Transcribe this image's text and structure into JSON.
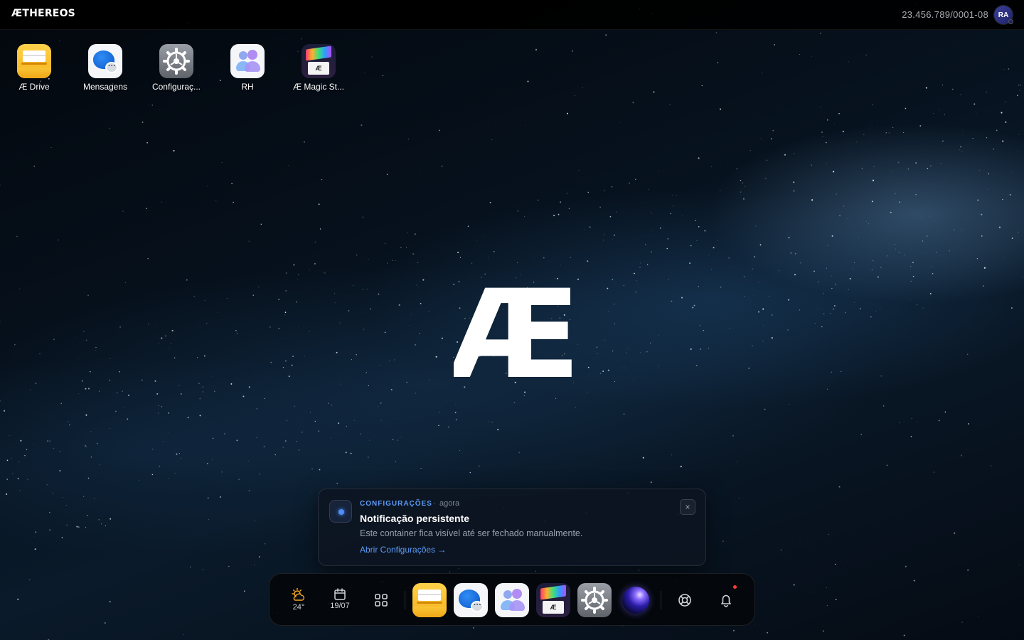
{
  "topbar": {
    "brand": "ÆTHEREOS",
    "tax_id": "23.456.789/0001-08",
    "avatar_initials": "RA"
  },
  "desktop": {
    "icons": [
      {
        "label": "Æ Drive",
        "icon": "drive-icon"
      },
      {
        "label": "Mensagens",
        "icon": "messages-icon"
      },
      {
        "label": "Configuraç...",
        "icon": "settings-gear-icon"
      },
      {
        "label": "RH",
        "icon": "people-icon"
      },
      {
        "label": "Æ Magic St...",
        "icon": "magic-store-icon"
      }
    ],
    "center_logo": "Æ"
  },
  "notification": {
    "app": "CONFIGURAÇÕES",
    "separator": "·",
    "time": "agora",
    "title": "Notificação persistente",
    "body": "Este container fica visível até ser fechado manualmente.",
    "link": "Abrir Configurações →",
    "close": "×",
    "accent_color": "#5b9af7"
  },
  "dock": {
    "weather": {
      "temp": "24°",
      "icon": "partly-cloudy-sun-icon"
    },
    "date": {
      "label": "19/07",
      "icon": "calendar-icon"
    },
    "launcher_icon": "grid-icon",
    "apps": [
      {
        "name": "Æ Drive",
        "icon": "drive-icon"
      },
      {
        "name": "Mensagens",
        "icon": "messages-icon"
      },
      {
        "name": "RH",
        "icon": "people-icon"
      },
      {
        "name": "Æ Magic Store",
        "icon": "magic-store-icon"
      },
      {
        "name": "Configurações",
        "icon": "settings-gear-icon"
      },
      {
        "name": "Orb",
        "icon": "orb-icon"
      }
    ],
    "support_icon": "lifebuoy-icon",
    "notifications_icon": "bell-icon",
    "notification_dot_color": "#ff3b3b",
    "magic_badge": "Æ"
  }
}
